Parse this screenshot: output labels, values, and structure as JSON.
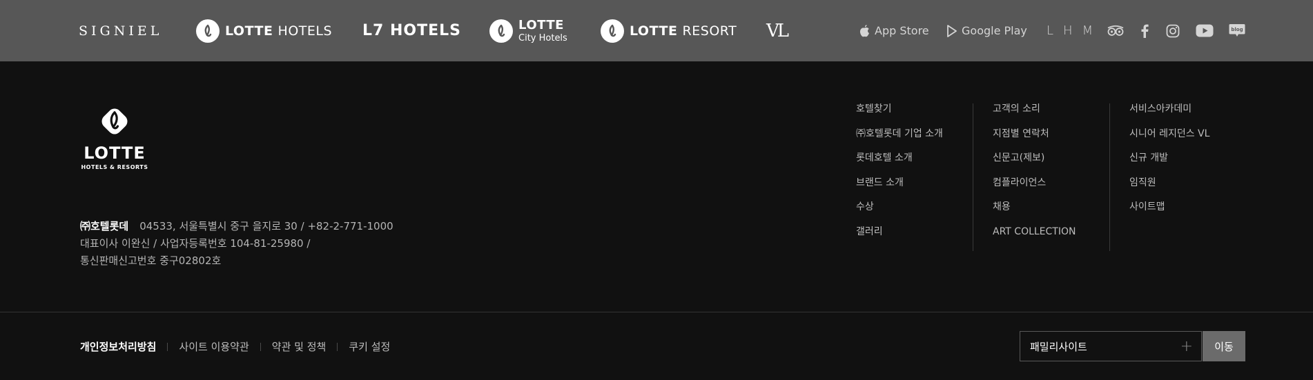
{
  "brands": {
    "signiel": "SIGNIEL",
    "lotte_hotels_bold": "LOTTE",
    "lotte_hotels_light": "HOTELS",
    "l7": "L7 HOTELS",
    "city_top": "LOTTE",
    "city_bottom": "City Hotels",
    "resort_bold": "LOTTE",
    "resort_light": "RESORT",
    "vl": "VL"
  },
  "stores": {
    "app_store": "App Store",
    "google_play": "Google Play"
  },
  "social": {
    "lhm": "LHM",
    "icons": [
      "tripadvisor-icon",
      "facebook-icon",
      "instagram-icon",
      "youtube-icon",
      "blog-icon"
    ],
    "blog_label": "blog"
  },
  "main_logo": {
    "word": "LOTTE",
    "sub": "HOTELS & RESORTS"
  },
  "company": {
    "name": "㈜호텔롯데",
    "address": "04533, 서울특별시 중구 을지로 30 / +82-2-771-1000",
    "ceo_reg": "대표이사 이완신 / 사업자등록번호 104-81-25980 /",
    "mail_order": "통신판매신고번호 중구02802호"
  },
  "links": {
    "col1": [
      "호텔찾기",
      "㈜호텔롯데 기업 소개",
      "롯데호텔 소개",
      "브랜드 소개",
      "수상",
      "갤러리"
    ],
    "col2": [
      "고객의 소리",
      "지점별 연락처",
      "신문고(제보)",
      "컴플라이언스",
      "채용",
      "ART COLLECTION"
    ],
    "col3": [
      "서비스아카데미",
      "시니어 레지던스 VL",
      "신규 개발",
      "임직원",
      "사이트맵"
    ]
  },
  "bottom": {
    "privacy": "개인정보처리방침",
    "terms": "사이트 이용약관",
    "policy": "약관 및 정책",
    "cookie": "쿠키 설정"
  },
  "family_site": {
    "label": "패밀리사이트",
    "plus": "+",
    "go": "이동"
  },
  "colors": {
    "top_bar": "#575757",
    "background": "#111111",
    "button": "#6b6b6b"
  }
}
